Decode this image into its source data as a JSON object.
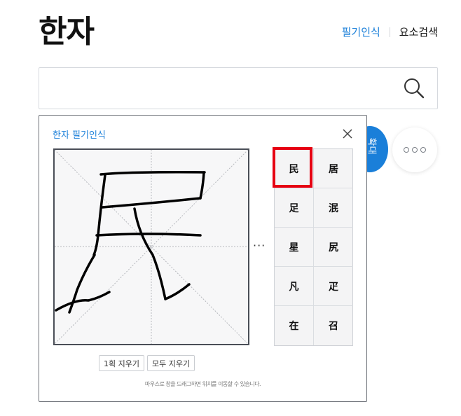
{
  "header": {
    "title": "한자",
    "links": [
      "필기인식",
      "요소검색"
    ]
  },
  "search": {
    "placeholder": ""
  },
  "side_button": {
    "label": "확대"
  },
  "panel": {
    "title": "한자 필기인식",
    "more_label": "···",
    "candidates": [
      "民",
      "居",
      "足",
      "泯",
      "星",
      "尻",
      "凡",
      "疋",
      "在",
      "召"
    ],
    "selected_candidate": "民",
    "buttons": {
      "undo_one": "1획 지우기",
      "clear_all": "모두 지우기"
    },
    "hint": "마우스로 창을 드래그하면 위치를 이동할 수 있습니다."
  },
  "colors": {
    "accent": "#1a7fd9",
    "highlight": "#e60012"
  },
  "icons": {
    "search": "search-icon",
    "close": "close-icon",
    "more": "more-icon"
  }
}
